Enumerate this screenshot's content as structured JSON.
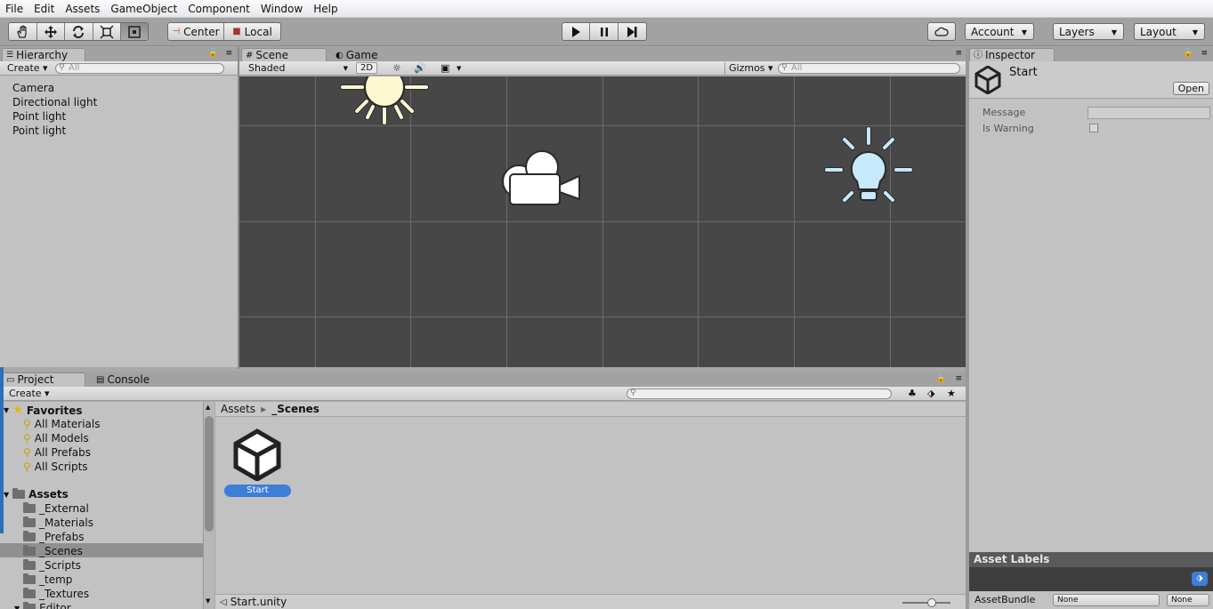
{
  "menu": [
    "File",
    "Edit",
    "Assets",
    "GameObject",
    "Component",
    "Window",
    "Help"
  ],
  "toolbar": {
    "pivot": "Center",
    "space": "Local",
    "account": "Account",
    "layers": "Layers",
    "layout": "Layout"
  },
  "hierarchy": {
    "tab": "Hierarchy",
    "create": "Create",
    "search_placeholder": "All",
    "items": [
      "Camera",
      "Directional light",
      "Point light",
      "Point light"
    ]
  },
  "scene": {
    "tab_scene": "Scene",
    "tab_game": "Game",
    "shading": "Shaded",
    "mode_2d": "2D",
    "gizmos": "Gizmos",
    "search_placeholder": "All"
  },
  "inspector": {
    "tab": "Inspector",
    "asset_name": "Start",
    "open_button": "Open",
    "fields": [
      {
        "label": "Message",
        "type": "text",
        "value": ""
      },
      {
        "label": "Is Warning",
        "type": "checkbox",
        "value": false
      }
    ],
    "asset_labels": "Asset Labels",
    "asset_bundle_label": "AssetBundle",
    "asset_bundle_value": "None",
    "asset_bundle_variant": "None"
  },
  "project": {
    "tab_project": "Project",
    "tab_console": "Console",
    "create": "Create",
    "favorites_label": "Favorites",
    "favorites": [
      "All Materials",
      "All Models",
      "All Prefabs",
      "All Scripts"
    ],
    "assets_label": "Assets",
    "folders": [
      "_External",
      "_Materials",
      "_Prefabs",
      "_Scenes",
      "_Scripts",
      "_temp",
      "_Textures",
      "Editor"
    ],
    "selected_folder": "_Scenes",
    "breadcrumb": [
      "Assets",
      "_Scenes"
    ],
    "files": [
      {
        "name": "Start",
        "selected": true
      }
    ],
    "footer_path": "Start.unity"
  },
  "colors": {
    "selection_blue": "#3d7ed8",
    "light_yellow": "#fdf7d2",
    "point_light_blue": "#c6e9fb"
  }
}
